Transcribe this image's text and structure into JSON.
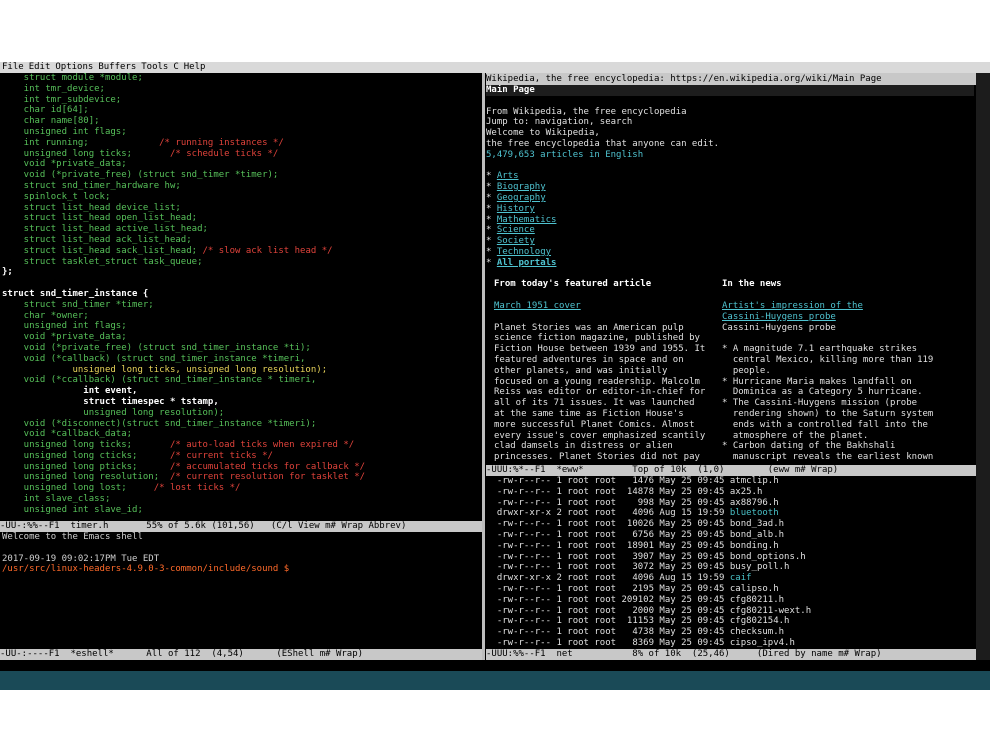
{
  "menu": [
    "File",
    "Edit",
    "Options",
    "Buffers",
    "Tools",
    "C",
    "Help"
  ],
  "code_lines": [
    [
      [
        "    struct module *module;",
        "gr"
      ]
    ],
    [
      [
        "    int tmr_device;",
        "gr"
      ]
    ],
    [
      [
        "    int tmr_subdevice;",
        "gr"
      ]
    ],
    [
      [
        "    char id[64];",
        "gr"
      ]
    ],
    [
      [
        "    char name[80];",
        "gr"
      ]
    ],
    [
      [
        "    unsigned int flags;",
        "gr"
      ]
    ],
    [
      [
        "    int running;",
        "gr"
      ],
      [
        "             /* running instances */",
        "rd"
      ]
    ],
    [
      [
        "    unsigned long ticks;",
        "gr"
      ],
      [
        "       /* schedule ticks */",
        "rd"
      ]
    ],
    [
      [
        "    void *private_data;",
        "gr"
      ]
    ],
    [
      [
        "    void (*private_free) (struct snd_timer *timer);",
        "gr"
      ]
    ],
    [
      [
        "    struct snd_timer_hardware hw;",
        "gr"
      ]
    ],
    [
      [
        "    spinlock_t lock;",
        "gr"
      ]
    ],
    [
      [
        "    struct list_head device_list;",
        "gr"
      ]
    ],
    [
      [
        "    struct list_head open_list_head;",
        "gr"
      ]
    ],
    [
      [
        "    struct list_head active_list_head;",
        "gr"
      ]
    ],
    [
      [
        "    struct list_head ack_list_head;",
        "gr"
      ]
    ],
    [
      [
        "    struct list_head sack_list_head;",
        "gr"
      ],
      [
        " /* slow ack list head */",
        "rd"
      ]
    ],
    [
      [
        "    struct tasklet_struct task_queue;",
        "gr"
      ]
    ],
    [
      [
        "};",
        "wh"
      ]
    ],
    [
      [
        "",
        ""
      ]
    ],
    [
      [
        "struct snd_timer_instance {",
        "wh"
      ]
    ],
    [
      [
        "    struct snd_timer *timer;",
        "gr"
      ]
    ],
    [
      [
        "    char *owner;",
        "gr"
      ]
    ],
    [
      [
        "    unsigned int flags;",
        "gr"
      ]
    ],
    [
      [
        "    void *private_data;",
        "gr"
      ]
    ],
    [
      [
        "    void (*private_free) (struct snd_timer_instance *ti);",
        "gr"
      ]
    ],
    [
      [
        "    void (*callback) (struct snd_timer_instance *timeri,",
        "gr"
      ]
    ],
    [
      [
        "             unsigned long ticks, unsigned long resolution);",
        "yl"
      ]
    ],
    [
      [
        "    void (*ccallback) (struct snd_timer_instance * timeri,",
        "gr"
      ]
    ],
    [
      [
        "               int event,",
        "wh"
      ]
    ],
    [
      [
        "               struct timespec * tstamp,",
        "wh"
      ]
    ],
    [
      [
        "               unsigned long resolution);",
        "gr"
      ]
    ],
    [
      [
        "    void (*disconnect)(struct snd_timer_instance *timeri);",
        "gr"
      ]
    ],
    [
      [
        "    void *callback_data;",
        "gr"
      ]
    ],
    [
      [
        "    unsigned long ticks;",
        "gr"
      ],
      [
        "       /* auto-load ticks when expired */",
        "rd"
      ]
    ],
    [
      [
        "    unsigned long cticks;",
        "gr"
      ],
      [
        "      /* current ticks */",
        "rd"
      ]
    ],
    [
      [
        "    unsigned long pticks;",
        "gr"
      ],
      [
        "      /* accumulated ticks for callback */",
        "rd"
      ]
    ],
    [
      [
        "    unsigned long resolution;",
        "gr"
      ],
      [
        "  /* current resolution for tasklet */",
        "rd"
      ]
    ],
    [
      [
        "    unsigned long lost;",
        "gr"
      ],
      [
        "     /* lost ticks */",
        "rd"
      ]
    ],
    [
      [
        "    int slave_class;",
        "gr"
      ]
    ],
    [
      [
        "    unsigned int slave_id;",
        "gr"
      ]
    ]
  ],
  "left_modeline": "-UU-:%%--F1  timer.h       55% of 5.6k (101,56)   (C/l View m# Wrap Abbrev)",
  "shell_lines": [
    {
      "text": "Welcome to the Emacs shell",
      "cls": ""
    },
    {
      "text": "",
      "cls": ""
    },
    {
      "text": "2017-09-19 09:02:17PM Tue EDT",
      "cls": ""
    },
    {
      "text": "/usr/src/linux-headers-4.9.0-3-common/include/sound $",
      "cls": "or"
    }
  ],
  "shell_modeline": "-UU-:----F1  *eshell*      All of 112  (4,54)      (EShell m# Wrap)",
  "wiki_title": "Wikipedia, the free encyclopedia: https://en.wikipedia.org/wiki/Main Page",
  "wiki": {
    "heading": "Main Page",
    "intro": [
      "From Wikipedia, the free encyclopedia",
      "Jump to: navigation, search",
      "Welcome to Wikipedia,",
      "the free encyclopedia that anyone can edit.",
      "5,479,653 articles in English"
    ],
    "portals": [
      "Arts",
      "Biography",
      "Geography",
      "History",
      "Mathematics",
      "Science",
      "Society",
      "Technology",
      "All portals"
    ],
    "featured_heading": "From today's featured article",
    "featured_caption": "March 1951 cover",
    "featured_text": [
      "Planet Stories was an American pulp",
      "science fiction magazine, published by",
      "Fiction House between 1939 and 1955. It",
      "featured adventures in space and on",
      "other planets, and was initially",
      "focused on a young readership. Malcolm",
      "Reiss was editor or editor-in-chief for",
      "all of its 71 issues. It was launched",
      "at the same time as Fiction House's",
      "more successful Planet Comics. Almost",
      "every issue's cover emphasized scantily",
      "clad damsels in distress or alien",
      "princesses. Planet Stories did not pay"
    ],
    "news_heading": "In the news",
    "news_caption": [
      "Artist's impression of the",
      "Cassini-Huygens probe",
      "Cassini-Huygens probe"
    ],
    "news_text": [
      "* A magnitude 7.1 earthquake strikes",
      "  central Mexico, killing more than 119",
      "  people.",
      "* Hurricane Maria makes landfall on",
      "  Dominica as a Category 5 hurricane.",
      "* The Cassini-Huygens mission (probe",
      "  rendering shown) to the Saturn system",
      "  ends with a controlled fall into the",
      "  atmosphere of the planet.",
      "* Carbon dating of the Bakhshali",
      "  manuscript reveals the earliest known"
    ]
  },
  "wiki_modeline": "-UUU:%*--F1  *eww*         Top of 10k  (1,0)        (eww m# Wrap)",
  "dired_rows": [
    [
      "-rw-r--r--",
      "1 root root",
      "1476",
      "May 25 09:45",
      "atmclip.h",
      ""
    ],
    [
      "-rw-r--r--",
      "1 root root",
      "14878",
      "May 25 09:45",
      "ax25.h",
      ""
    ],
    [
      "-rw-r--r--",
      "1 root root",
      "998",
      "May 25 09:45",
      "ax88796.h",
      ""
    ],
    [
      "drwxr-xr-x",
      "2 root root",
      "4096",
      "Aug 15 19:59",
      "bluetooth",
      "dir"
    ],
    [
      "-rw-r--r--",
      "1 root root",
      "10026",
      "May 25 09:45",
      "bond_3ad.h",
      ""
    ],
    [
      "-rw-r--r--",
      "1 root root",
      "6756",
      "May 25 09:45",
      "bond_alb.h",
      ""
    ],
    [
      "-rw-r--r--",
      "1 root root",
      "18901",
      "May 25 09:45",
      "bonding.h",
      ""
    ],
    [
      "-rw-r--r--",
      "1 root root",
      "3907",
      "May 25 09:45",
      "bond_options.h",
      ""
    ],
    [
      "-rw-r--r--",
      "1 root root",
      "3072",
      "May 25 09:45",
      "busy_poll.h",
      ""
    ],
    [
      "drwxr-xr-x",
      "2 root root",
      "4096",
      "Aug 15 19:59",
      "caif",
      "dir"
    ],
    [
      "-rw-r--r--",
      "1 root root",
      "2195",
      "May 25 09:45",
      "calipso.h",
      ""
    ],
    [
      "-rw-r--r--",
      "1 root root",
      "209102",
      "May 25 09:45",
      "cfg80211.h",
      ""
    ],
    [
      "-rw-r--r--",
      "1 root root",
      "2000",
      "May 25 09:45",
      "cfg80211-wext.h",
      ""
    ],
    [
      "-rw-r--r--",
      "1 root root",
      "11153",
      "May 25 09:45",
      "cfg802154.h",
      ""
    ],
    [
      "-rw-r--r--",
      "1 root root",
      "4738",
      "May 25 09:45",
      "checksum.h",
      ""
    ],
    [
      "-rw-r--r--",
      "1 root root",
      "8369",
      "May 25 09:45",
      "cipso_ipv4.h",
      ""
    ]
  ],
  "dired_modeline": "-UUU:%%--F1  net           8% of 10k  (25,46)     (Dired by name m# Wrap)"
}
